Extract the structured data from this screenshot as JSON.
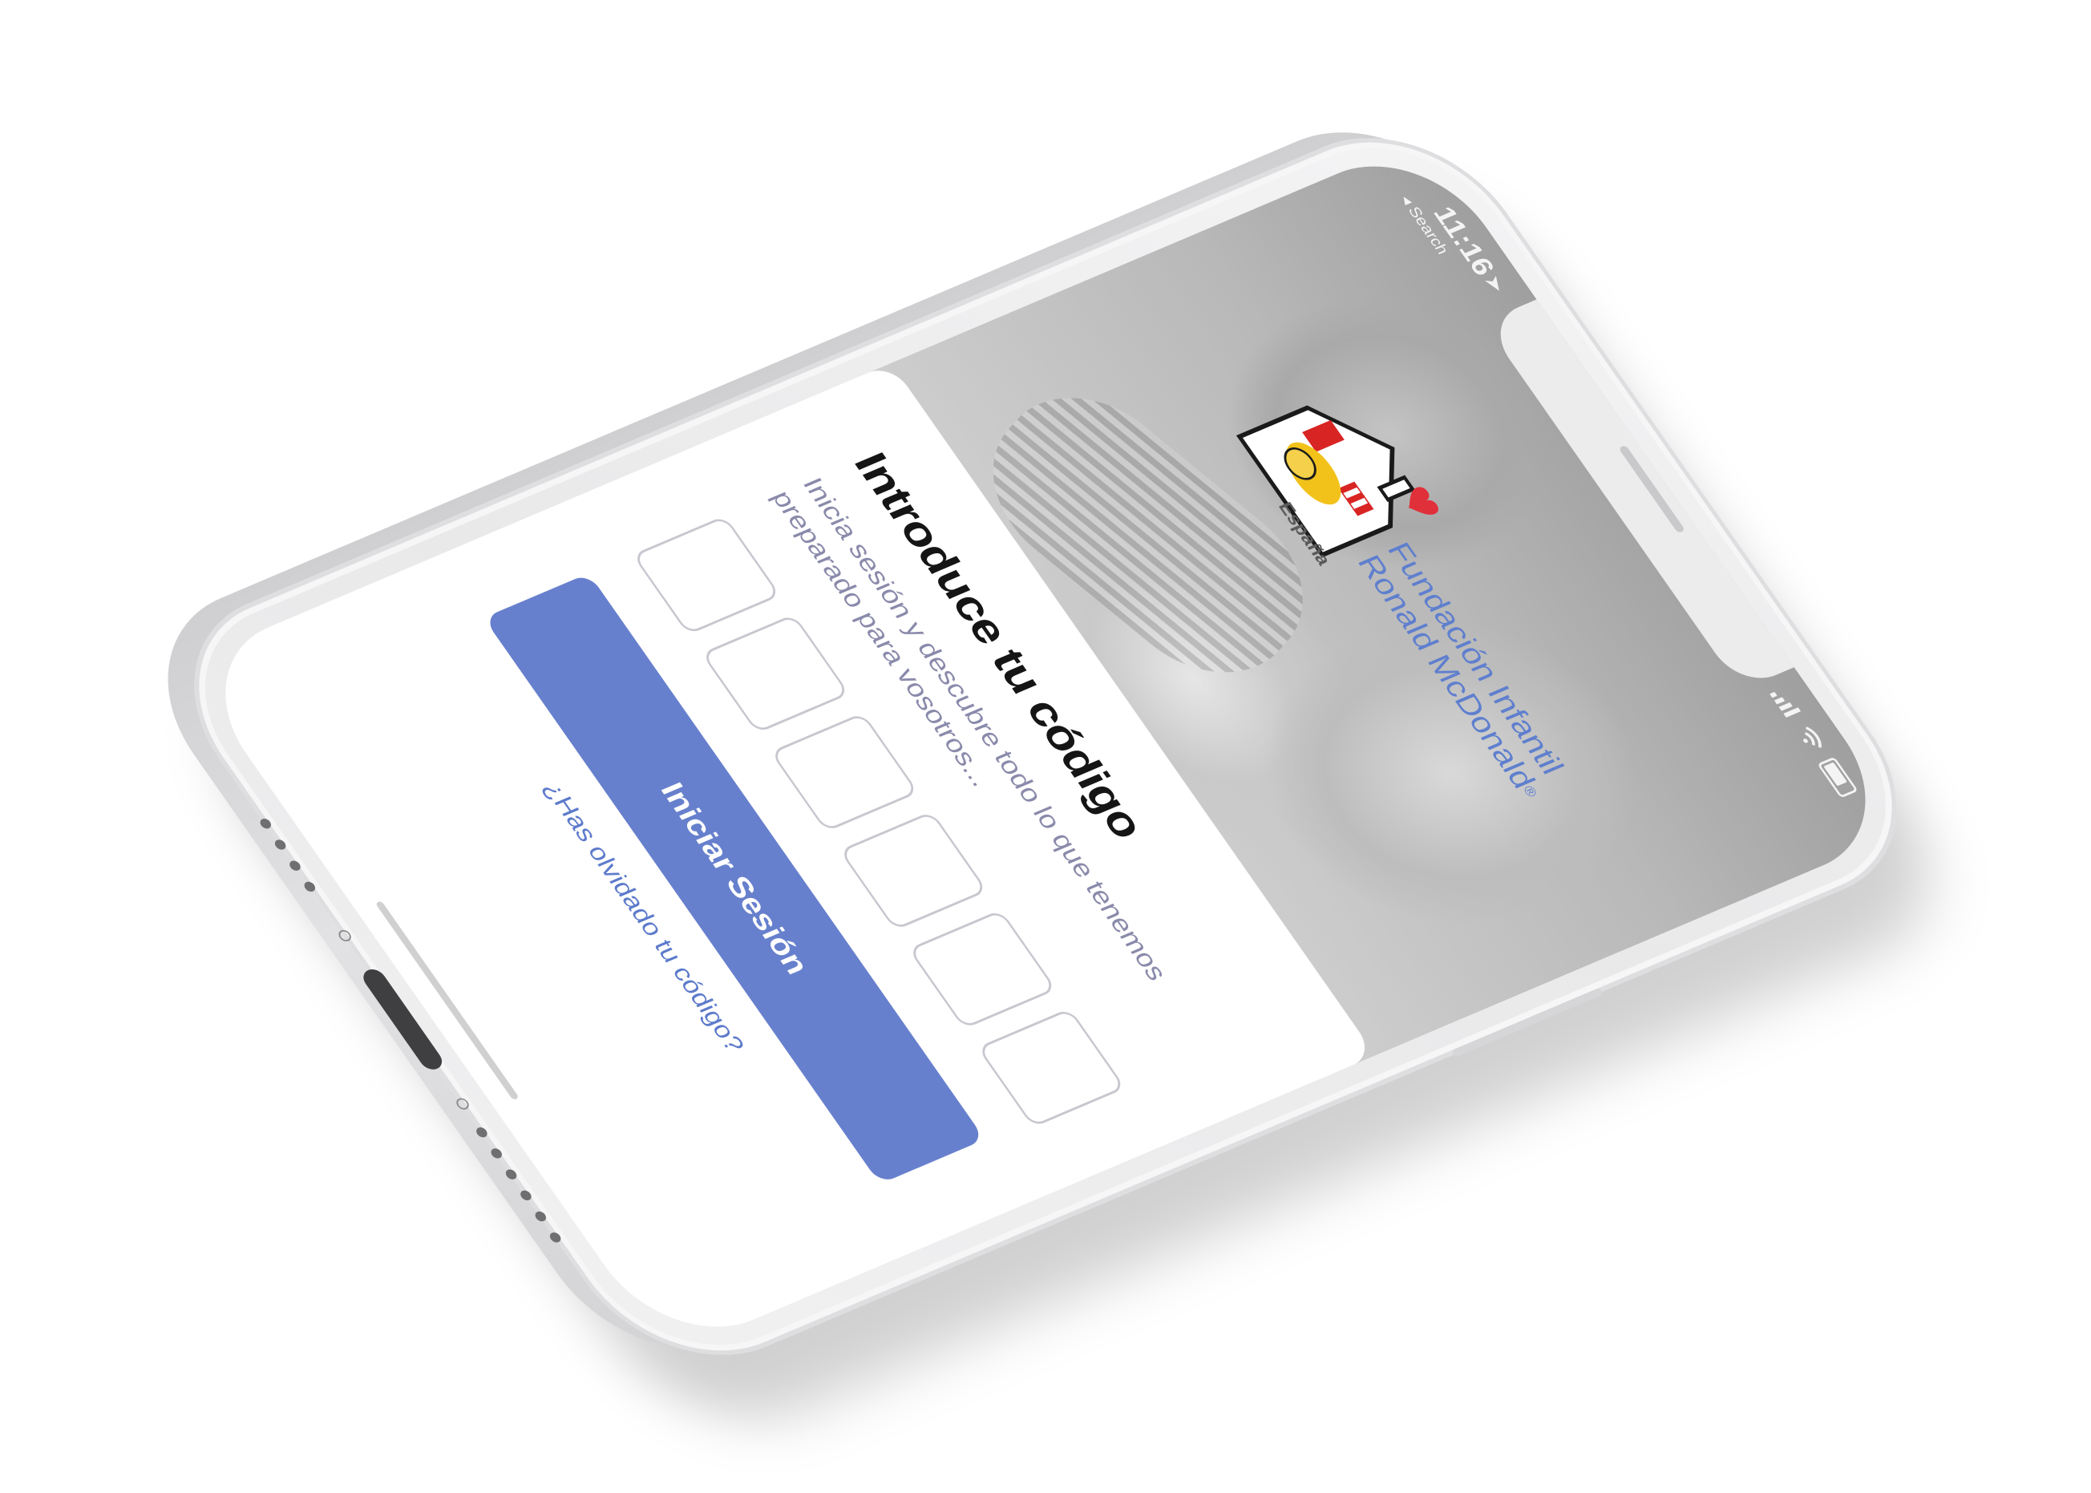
{
  "status_bar": {
    "time": "11:16",
    "back_label": "◂ Search",
    "location_glyph": "➤"
  },
  "logo": {
    "line1": "Fundación Infantil",
    "line2": "Ronald McDonald",
    "registered": "®",
    "subline": "España"
  },
  "login": {
    "title": "Introduce tu código",
    "subtitle": "Inicia sesión y descubre todo lo que tenemos preparado para vosotros...",
    "code_digits": [
      "",
      "",
      "",
      "",
      "",
      ""
    ],
    "submit_label": "Iniciar Sesión",
    "forgot_label": "¿Has olvidado tu código?"
  },
  "colors": {
    "accent": "#6780cd",
    "link": "#5d7bcb",
    "logo_blue": "#5f7fce",
    "subtitle": "#8a8aab"
  }
}
